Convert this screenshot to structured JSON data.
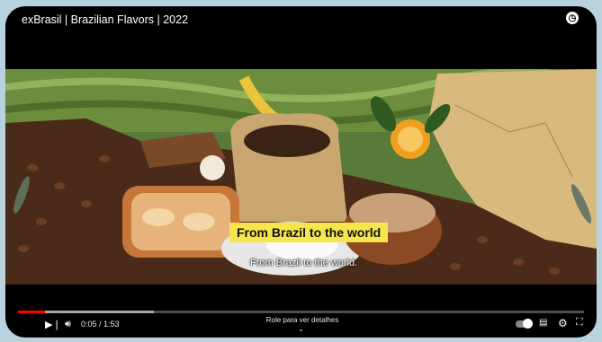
{
  "video": {
    "title": "exBrasil | Brazilian Flavors | 2022",
    "caption": "From Brazil to the world",
    "subtitle": "From Brazil to the world.",
    "progress_fraction": 0.047
  },
  "controls": {
    "current_time": "0:05",
    "duration": "1:53",
    "time_display": "0:05 / 1:53",
    "scroll_hint": "Role para ver detalhes"
  },
  "colors": {
    "progress": "#ff0000",
    "caption_bg": "#f7e64b",
    "page_bg": "#b9d3de"
  }
}
